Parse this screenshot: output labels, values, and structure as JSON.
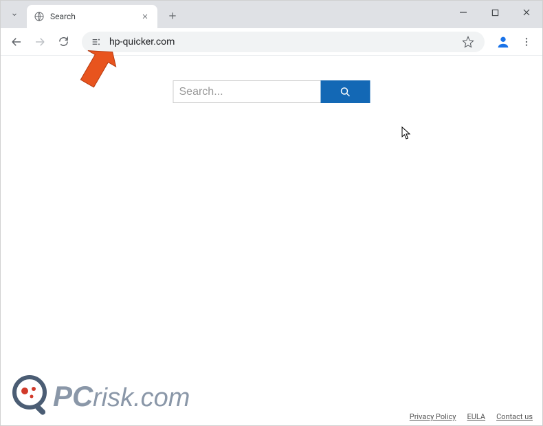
{
  "window": {
    "tab_title": "Search"
  },
  "toolbar": {
    "url": "hp-quicker.com"
  },
  "search": {
    "placeholder": "Search...",
    "value": ""
  },
  "footer": {
    "logo_text": "PCrisk.com",
    "links": {
      "privacy": "Privacy Policy",
      "eula": "EULA",
      "contact": "Contact us"
    }
  }
}
